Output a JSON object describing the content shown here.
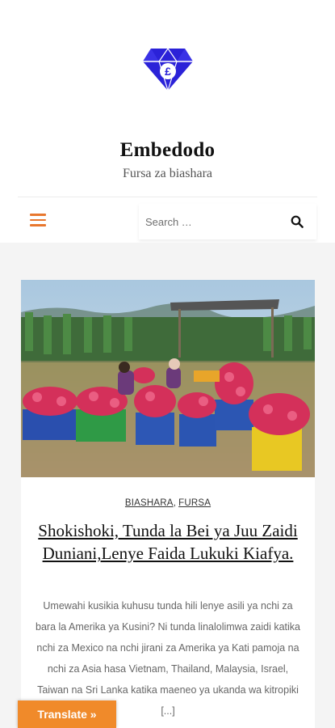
{
  "site": {
    "title": "Embedodo",
    "tagline": "Fursa za biashara"
  },
  "nav": {
    "search_placeholder": "Search …"
  },
  "post": {
    "categories": [
      "BIASHARA",
      "FURSA"
    ],
    "category_separator": ",",
    "title": "Shokishoki, Tunda la Bei ya Juu Zaidi Duniani,Lenye Faida Lukuki Kiafya.",
    "excerpt": "Umewahi kusikia kuhusu tunda hili lenye asili ya nchi za bara la Amerika ya Kusini? Ni tunda linalolimwa zaidi katika nchi za Mexico na nchi jirani za Amerika ya Kati pamoja na nchi za Asia hasa Vietnam, Thailand, Malaysia, Israel, Taiwan na Sri Lanka katika maeneo ya ukanda wa kitropiki [...]",
    "image_subject": "dragon fruit harvest crates"
  },
  "translate": {
    "label": "Translate »"
  },
  "colors": {
    "accent": "#e8772e",
    "logo": "#2b22d8",
    "translate_bg": "#f08a2a",
    "content_bg": "#f4f4f4"
  },
  "icons": [
    "diamond-pound-logo",
    "menu-icon",
    "search-icon"
  ]
}
